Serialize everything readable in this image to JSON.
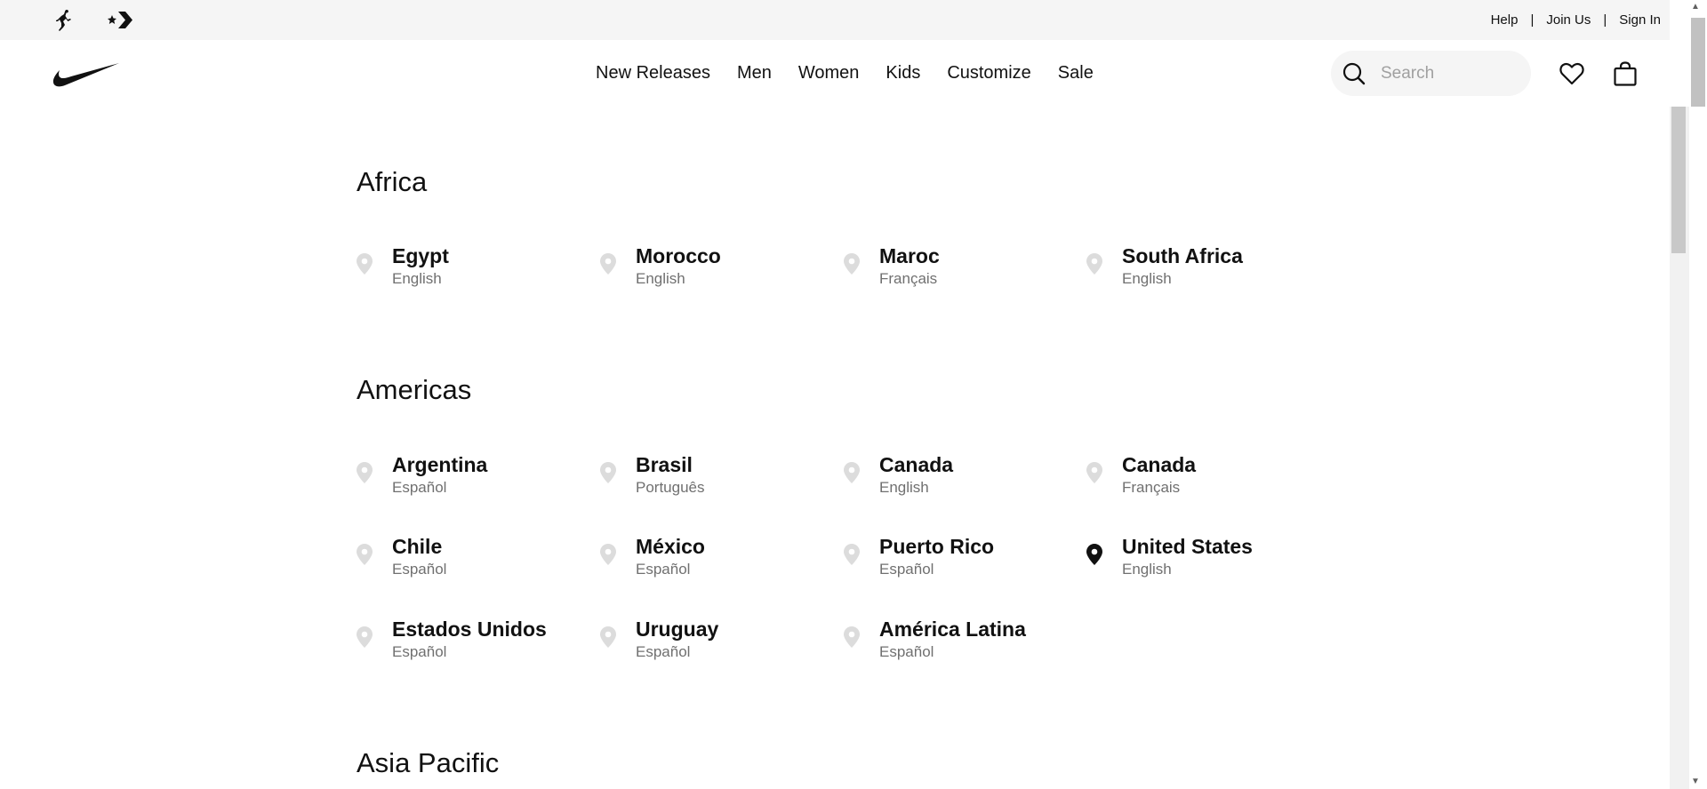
{
  "utility_bar": {
    "links": [
      "Help",
      "Join Us",
      "Sign In"
    ],
    "separator": "|"
  },
  "brand_icons": [
    "jordan-jumpman-icon",
    "converse-star-chevron-icon"
  ],
  "header": {
    "logo": "nike-swoosh-logo",
    "nav": [
      "New Releases",
      "Men",
      "Women",
      "Kids",
      "Customize",
      "Sale"
    ],
    "search": {
      "placeholder": "Search",
      "value": ""
    },
    "icons": [
      "favorites-heart-icon",
      "bag-icon"
    ]
  },
  "regions": [
    {
      "title": "Africa",
      "locations": [
        {
          "country": "Egypt",
          "language": "English",
          "selected": false
        },
        {
          "country": "Morocco",
          "language": "English",
          "selected": false
        },
        {
          "country": "Maroc",
          "language": "Français",
          "selected": false
        },
        {
          "country": "South Africa",
          "language": "English",
          "selected": false
        }
      ]
    },
    {
      "title": "Americas",
      "locations": [
        {
          "country": "Argentina",
          "language": "Español",
          "selected": false
        },
        {
          "country": "Brasil",
          "language": "Português",
          "selected": false
        },
        {
          "country": "Canada",
          "language": "English",
          "selected": false
        },
        {
          "country": "Canada",
          "language": "Français",
          "selected": false
        },
        {
          "country": "Chile",
          "language": "Español",
          "selected": false
        },
        {
          "country": "México",
          "language": "Español",
          "selected": false
        },
        {
          "country": "Puerto Rico",
          "language": "Español",
          "selected": false
        },
        {
          "country": "United States",
          "language": "English",
          "selected": true
        },
        {
          "country": "Estados Unidos",
          "language": "Español",
          "selected": false
        },
        {
          "country": "Uruguay",
          "language": "Español",
          "selected": false
        },
        {
          "country": "América Latina",
          "language": "Español",
          "selected": false
        }
      ]
    },
    {
      "title": "Asia Pacific",
      "locations": []
    }
  ],
  "colors": {
    "pin_inactive": "#dcdcdc",
    "pin_selected": "#111111",
    "language_text": "#707070",
    "utility_bg": "#f5f5f5"
  }
}
